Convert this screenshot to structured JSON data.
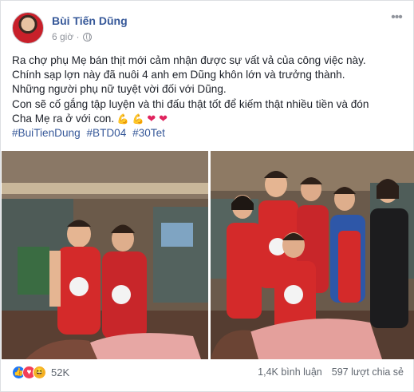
{
  "post": {
    "author": "Bùi Tiến Dũng",
    "time": "6 giờ ·",
    "privacy_icon": "globe-icon",
    "more_icon": "more-horizontal-icon",
    "lines": [
      "Ra chợ phụ Mẹ bán thịt mới cảm nhận được sự vất vả của công việc này.",
      "Chính sạp lợn này đã nuôi 4 anh em Dũng khôn lớn và trưởng thành.",
      "Những người phụ nữ tuyệt vời đối với Dũng.",
      "Con sẽ cố gắng tập luyện và thi đấu thật tốt để kiếm thật nhiều tiền và đón",
      "Cha Mẹ ra ở với con."
    ],
    "emojis": [
      "muscle-emoji",
      "muscle-emoji",
      "heart-emoji",
      "heart-emoji"
    ],
    "hashtags": [
      "#BuiTienDung",
      "#BTD04",
      "#30Tet"
    ]
  },
  "reactions": {
    "icons": [
      "like-icon",
      "love-icon",
      "haha-icon"
    ],
    "count": "52K",
    "comments": "1,4K bình luận",
    "shares": "597 lượt chia sẻ"
  },
  "colors": {
    "link": "#365899",
    "secondary": "#90949c",
    "apron": "#d42a2a"
  }
}
